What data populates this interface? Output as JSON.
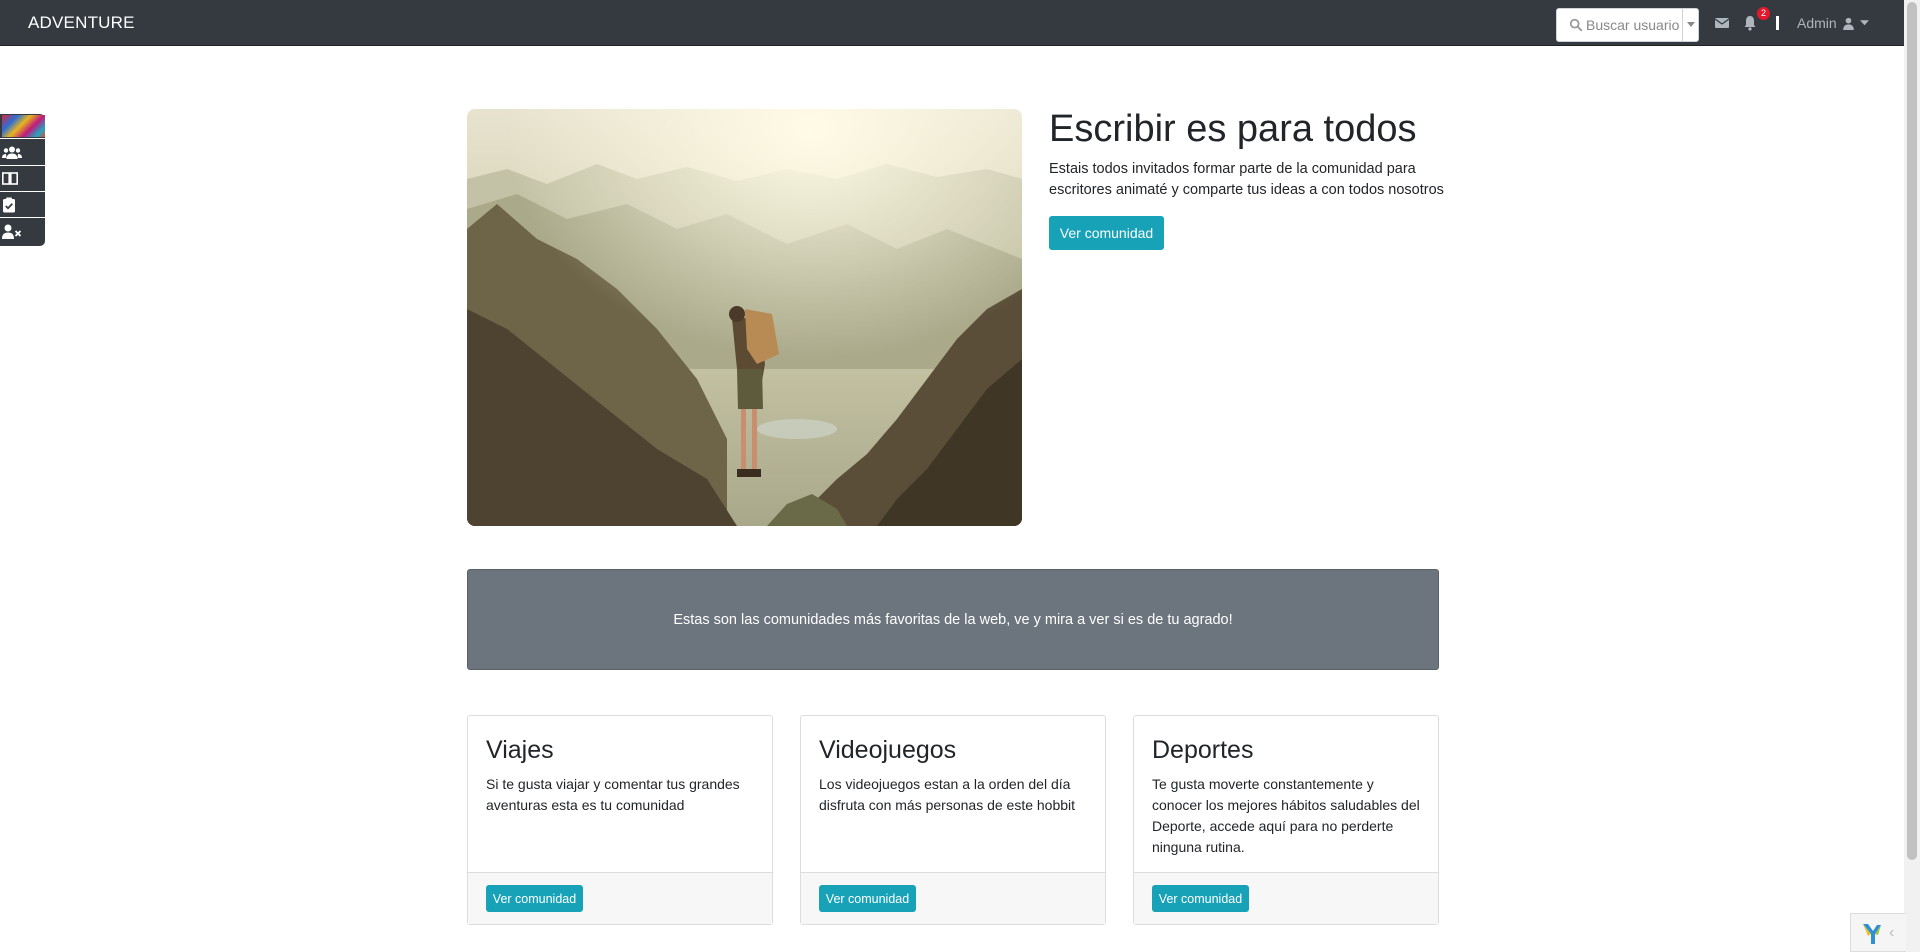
{
  "navbar": {
    "brand": "ADVENTURE",
    "search_placeholder": "Buscar usuario",
    "notifications_count": "2",
    "user_label": "Admin"
  },
  "sidebar": {
    "items": [
      {
        "icon": "thumbnail-image"
      },
      {
        "icon": "users-icon"
      },
      {
        "icon": "book-open-icon"
      },
      {
        "icon": "clipboard-check-icon"
      },
      {
        "icon": "user-times-icon"
      }
    ]
  },
  "hero": {
    "title": "Escribir es para todos",
    "text": "Estais todos invitados formar parte de la comunidad para escritores animaté y comparte tus ideas a con todos nosotros",
    "button": "Ver comunidad"
  },
  "banner": {
    "text": "Estas son las comunidades más favoritas de la web, ve y mira a ver si es de tu agrado!"
  },
  "cards": [
    {
      "title": "Viajes",
      "text": "Si te gusta viajar y comentar tus grandes aventuras esta es tu comunidad",
      "button": "Ver comunidad"
    },
    {
      "title": "Videojuegos",
      "text": "Los videojuegos estan a la orden del día disfruta con más personas de este hobbit",
      "button": "Ver comunidad"
    },
    {
      "title": "Deportes",
      "text": "Te gusta moverte constantemente y conocer los mejores hábitos saludables del Deporte, accede aquí para no perderte ninguna rutina.",
      "button": "Ver comunidad"
    }
  ],
  "colors": {
    "navbar": "#343a40",
    "accent": "#17a2b8",
    "banner": "#6c757d",
    "badge": "#e3182d"
  }
}
